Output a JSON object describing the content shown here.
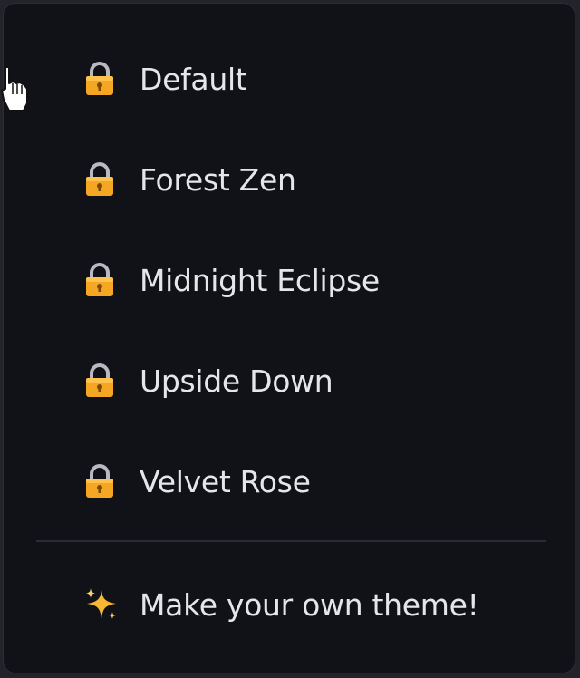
{
  "theme_menu": {
    "items": [
      {
        "label": "Default",
        "icon": "lock-icon"
      },
      {
        "label": "Forest Zen",
        "icon": "lock-icon"
      },
      {
        "label": "Midnight Eclipse",
        "icon": "lock-icon"
      },
      {
        "label": "Upside Down",
        "icon": "lock-icon"
      },
      {
        "label": "Velvet Rose",
        "icon": "lock-icon"
      }
    ],
    "custom_action": {
      "label": "Make your own theme!",
      "icon": "sparkles-icon"
    }
  },
  "colors": {
    "background": "#111118",
    "text": "#e6e6ea",
    "lock": "#f5a623",
    "sparkle": "#f7b733"
  }
}
